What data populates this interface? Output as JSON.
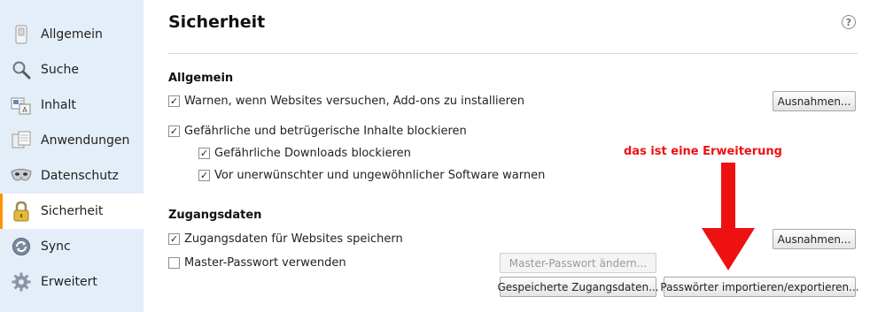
{
  "sidebar": {
    "items": [
      {
        "label": "Allgemein",
        "icon": "general-switch-icon"
      },
      {
        "label": "Suche",
        "icon": "magnifier-icon"
      },
      {
        "label": "Inhalt",
        "icon": "content-document-icon"
      },
      {
        "label": "Anwendungen",
        "icon": "applications-icon"
      },
      {
        "label": "Datenschutz",
        "icon": "privacy-mask-icon"
      },
      {
        "label": "Sicherheit",
        "icon": "padlock-icon",
        "active": true
      },
      {
        "label": "Sync",
        "icon": "sync-icon"
      },
      {
        "label": "Erweitert",
        "icon": "gear-icon"
      }
    ]
  },
  "main": {
    "title": "Sicherheit",
    "help": "?",
    "general": {
      "heading": "Allgemein",
      "warn_addons": {
        "label": "Warnen, wenn Websites versuchen, Add-ons zu installieren",
        "checked": true
      },
      "exceptions_button": "Ausnahmen...",
      "block_dangerous": {
        "label": "Gefährliche und betrügerische Inhalte blockieren",
        "checked": true
      },
      "block_downloads": {
        "label": "Gefährliche Downloads blockieren",
        "checked": true
      },
      "warn_software": {
        "label": "Vor unerwünschter und ungewöhnlicher Software warnen",
        "checked": true
      }
    },
    "logins": {
      "heading": "Zugangsdaten",
      "save_logins": {
        "label": "Zugangsdaten für Websites speichern",
        "checked": true
      },
      "exceptions_button": "Ausnahmen...",
      "master_password": {
        "label": "Master-Passwort verwenden",
        "checked": false
      },
      "change_master_button": "Master-Passwort ändern...",
      "saved_logins_button": "Gespeicherte Zugangsdaten...",
      "import_export_button": "Passwörter importieren/exportieren..."
    },
    "annotation": "das ist eine Erweiterung"
  },
  "colors": {
    "sidebar_bg": "#e4eef8",
    "active_accent": "#ff9400",
    "annotation_red": "#ee1111"
  }
}
